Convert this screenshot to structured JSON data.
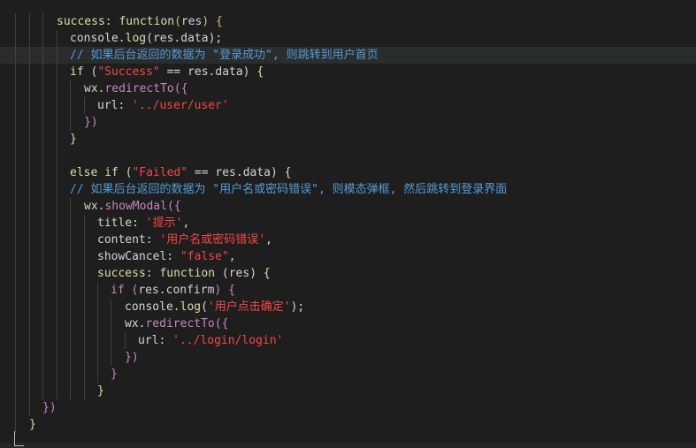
{
  "editor": {
    "lines": [
      [
        {
          "t": "success",
          "c": "c-yellow"
        },
        {
          "t": ": ",
          "c": "c-white"
        },
        {
          "t": "function",
          "c": "c-yellow"
        },
        {
          "t": "(",
          "c": "c-paren"
        },
        {
          "t": "res",
          "c": "c-white"
        },
        {
          "t": ") ",
          "c": "c-paren"
        },
        {
          "t": "{",
          "c": "c-paren"
        }
      ],
      [
        {
          "t": "console",
          "c": "c-white"
        },
        {
          "t": ".",
          "c": "c-white"
        },
        {
          "t": "log",
          "c": "c-yellow"
        },
        {
          "t": "(",
          "c": "c-white"
        },
        {
          "t": "res.data",
          "c": "c-white"
        },
        {
          "t": ");",
          "c": "c-white"
        }
      ],
      [
        {
          "t": "// 如果后台返回的数据为 \"登录成功\", 则跳转到用户首页",
          "c": "c-blue"
        }
      ],
      [
        {
          "t": "if ",
          "c": "c-yellow"
        },
        {
          "t": "(",
          "c": "c-white"
        },
        {
          "t": "\"Success\"",
          "c": "c-red"
        },
        {
          "t": " == res.data) ",
          "c": "c-white"
        },
        {
          "t": "{",
          "c": "c-yellow"
        }
      ],
      [
        {
          "t": "wx.",
          "c": "c-white"
        },
        {
          "t": "redirectTo",
          "c": "c-pink"
        },
        {
          "t": "({",
          "c": "c-pink"
        }
      ],
      [
        {
          "t": "url",
          "c": "c-white"
        },
        {
          "t": ": ",
          "c": "c-white"
        },
        {
          "t": "'../user/user'",
          "c": "c-red"
        }
      ],
      [
        {
          "t": "})",
          "c": "c-pink"
        }
      ],
      [
        {
          "t": "}",
          "c": "c-yellow"
        }
      ],
      [],
      [
        {
          "t": "else if ",
          "c": "c-yellow"
        },
        {
          "t": "(",
          "c": "c-white"
        },
        {
          "t": "\"Failed\"",
          "c": "c-red"
        },
        {
          "t": " == res.data) ",
          "c": "c-white"
        },
        {
          "t": "{",
          "c": "c-yellow"
        }
      ],
      [
        {
          "t": "// 如果后台返回的数据为 \"用户名或密码错误\", 则模态弹框, 然后跳转到登录界面",
          "c": "c-blue"
        }
      ],
      [
        {
          "t": "wx.",
          "c": "c-white"
        },
        {
          "t": "showModal",
          "c": "c-pink"
        },
        {
          "t": "({",
          "c": "c-pink"
        }
      ],
      [
        {
          "t": "title",
          "c": "c-white"
        },
        {
          "t": ": ",
          "c": "c-white"
        },
        {
          "t": "'提示'",
          "c": "c-red"
        },
        {
          "t": ",",
          "c": "c-white"
        }
      ],
      [
        {
          "t": "content",
          "c": "c-white"
        },
        {
          "t": ": ",
          "c": "c-white"
        },
        {
          "t": "'用户名或密码错误'",
          "c": "c-red"
        },
        {
          "t": ",",
          "c": "c-white"
        }
      ],
      [
        {
          "t": "showCancel",
          "c": "c-white"
        },
        {
          "t": ": ",
          "c": "c-white"
        },
        {
          "t": "\"false\"",
          "c": "c-red"
        },
        {
          "t": ",",
          "c": "c-white"
        }
      ],
      [
        {
          "t": "success",
          "c": "c-yellow"
        },
        {
          "t": ": ",
          "c": "c-white"
        },
        {
          "t": "function ",
          "c": "c-yellow"
        },
        {
          "t": "(",
          "c": "c-yellow"
        },
        {
          "t": "res",
          "c": "c-white"
        },
        {
          "t": ") ",
          "c": "c-yellow"
        },
        {
          "t": "{",
          "c": "c-yellow"
        }
      ],
      [
        {
          "t": "if ",
          "c": "c-pink"
        },
        {
          "t": "(",
          "c": "c-pink"
        },
        {
          "t": "res.confirm",
          "c": "c-white"
        },
        {
          "t": ") ",
          "c": "c-pink"
        },
        {
          "t": "{",
          "c": "c-pink"
        }
      ],
      [
        {
          "t": "console",
          "c": "c-white"
        },
        {
          "t": ".",
          "c": "c-white"
        },
        {
          "t": "log",
          "c": "c-yellow"
        },
        {
          "t": "(",
          "c": "c-white"
        },
        {
          "t": "'用户点击确定'",
          "c": "c-red"
        },
        {
          "t": ");",
          "c": "c-white"
        }
      ],
      [
        {
          "t": "wx.",
          "c": "c-white"
        },
        {
          "t": "redirectTo",
          "c": "c-pink"
        },
        {
          "t": "({",
          "c": "c-pink"
        }
      ],
      [
        {
          "t": "url",
          "c": "c-white"
        },
        {
          "t": ": ",
          "c": "c-white"
        },
        {
          "t": "'../login/login'",
          "c": "c-red"
        }
      ],
      [
        {
          "t": "})",
          "c": "c-pink"
        }
      ],
      [
        {
          "t": "}",
          "c": "c-pink"
        }
      ],
      [
        {
          "t": "}",
          "c": "c-yellow"
        }
      ],
      [
        {
          "t": "})",
          "c": "c-pink"
        }
      ],
      [
        {
          "t": "}",
          "c": "c-yellow"
        }
      ]
    ]
  }
}
